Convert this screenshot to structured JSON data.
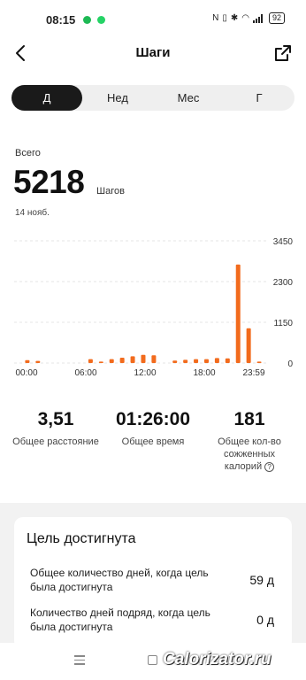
{
  "status_bar": {
    "time": "08:15",
    "icons": [
      "spotify-icon",
      "whatsapp-icon",
      "nfc-icon",
      "vibrate-icon",
      "bluetooth-icon",
      "wifi-icon",
      "signal-icon"
    ],
    "battery": "92",
    "colors": {
      "spotify": "#1db954",
      "whatsapp": "#25d366"
    }
  },
  "header": {
    "title": "Шаги",
    "back_icon": "chevron-left-icon",
    "share_icon": "share-icon"
  },
  "tabs": [
    {
      "label": "Д",
      "active": true
    },
    {
      "label": "Нед",
      "active": false
    },
    {
      "label": "Мес",
      "active": false
    },
    {
      "label": "Г",
      "active": false
    }
  ],
  "summary": {
    "total_label": "Всего",
    "total_value": "5218",
    "unit": "Шагов",
    "date": "14 нояб."
  },
  "chart_data": {
    "type": "bar",
    "bar_color": "#f26b1d",
    "ylim": [
      0,
      3450
    ],
    "y_ticks": [
      "3450",
      "2300",
      "1150",
      "0"
    ],
    "x_ticks": [
      "00:00",
      "06:00",
      "12:00",
      "18:00",
      "23:59"
    ],
    "categories": [
      "00:00",
      "00:30",
      "01:00",
      "01:30",
      "02:00",
      "02:30",
      "03:00",
      "03:30",
      "04:00",
      "04:30",
      "05:00",
      "05:30",
      "06:00",
      "06:30",
      "07:00",
      "07:30",
      "08:00",
      "08:30",
      "09:00",
      "09:30",
      "10:00",
      "10:30",
      "11:00",
      "11:30",
      "12:00",
      "12:30",
      "13:00",
      "13:30",
      "14:00",
      "14:30",
      "15:00",
      "15:30",
      "16:00",
      "16:30",
      "17:00",
      "17:30",
      "18:00",
      "18:30",
      "19:00",
      "19:30",
      "20:00",
      "20:30",
      "21:00",
      "21:30",
      "22:00",
      "22:30",
      "23:00",
      "23:30"
    ],
    "values": [
      0,
      0,
      80,
      0,
      60,
      0,
      0,
      0,
      0,
      0,
      0,
      0,
      0,
      0,
      110,
      0,
      40,
      0,
      110,
      0,
      150,
      0,
      190,
      0,
      230,
      0,
      220,
      0,
      0,
      0,
      70,
      0,
      90,
      0,
      110,
      0,
      110,
      0,
      140,
      0,
      130,
      0,
      2780,
      0,
      980,
      0,
      40,
      0
    ]
  },
  "stats": [
    {
      "value": "3,51",
      "label": "Общее расстояние"
    },
    {
      "value": "01:26:00",
      "label": "Общее время"
    },
    {
      "value": "181",
      "label": "Общее кол-во сожженных калорий"
    }
  ],
  "goal": {
    "title": "Цель достигнута",
    "rows": [
      {
        "label": "Общее количество дней, когда цель была достигнута",
        "value": "59 д"
      },
      {
        "label": "Количество дней подряд, когда цель была достигнута",
        "value": "0 д"
      }
    ]
  },
  "watermark": "Calorizator.ru"
}
